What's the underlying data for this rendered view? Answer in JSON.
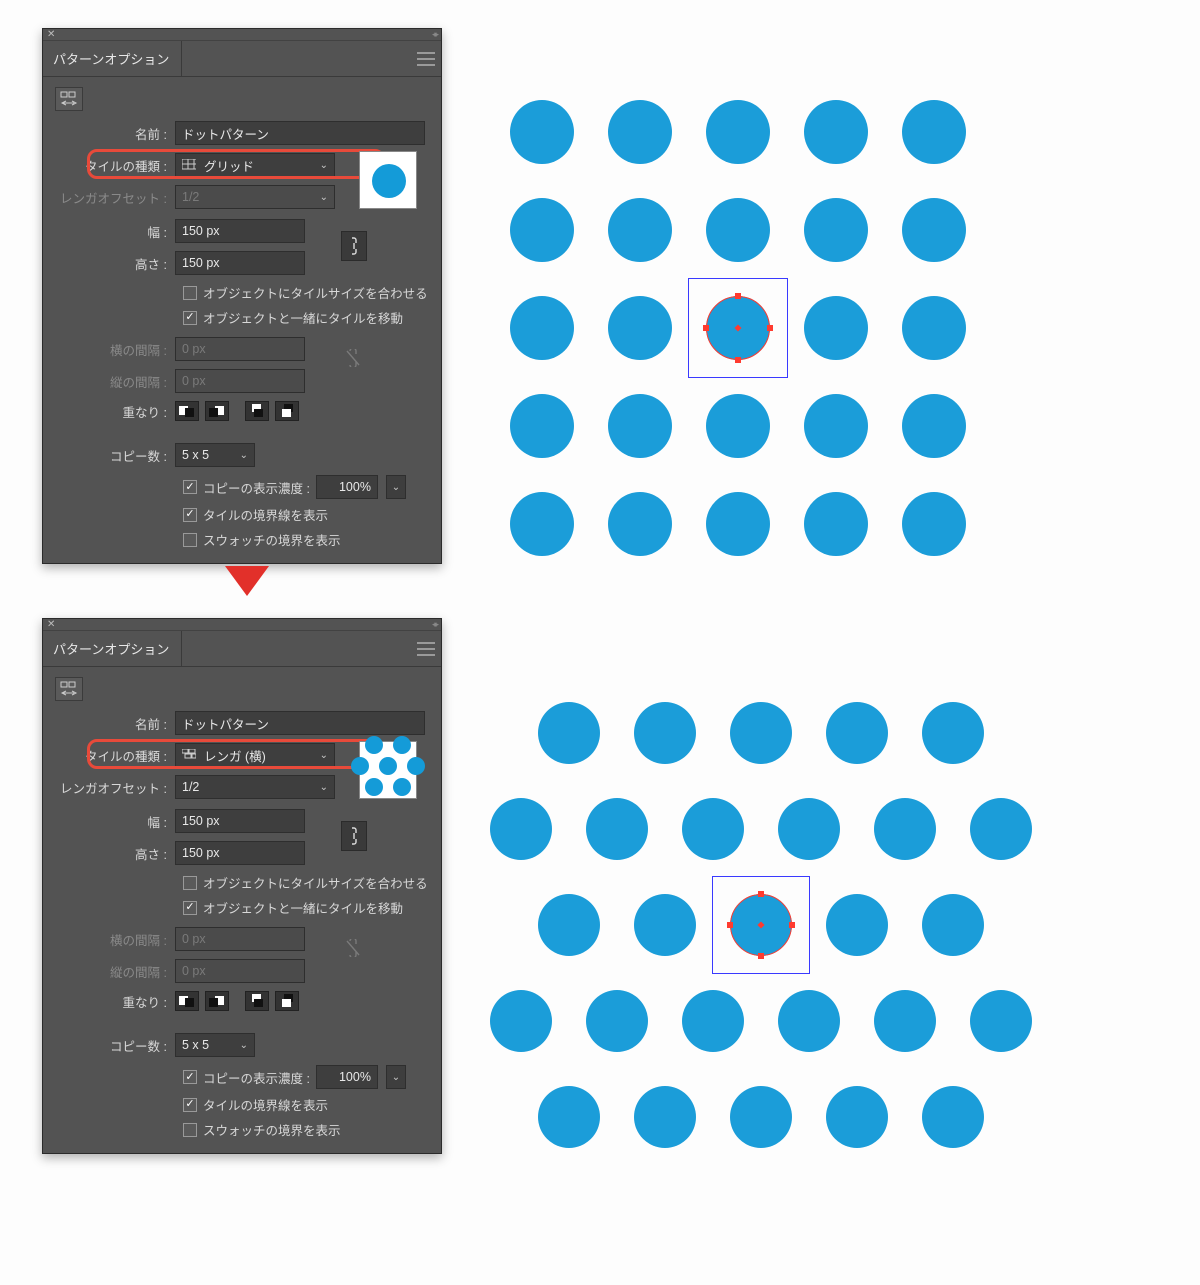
{
  "panel_title": "パターンオプション",
  "labels": {
    "name": "名前 :",
    "tile_type": "タイルの種類 :",
    "brick_offset": "レンガオフセット :",
    "width": "幅 :",
    "height": "高さ :",
    "h_spacing": "横の間隔 :",
    "v_spacing": "縦の間隔 :",
    "overlap": "重なり :",
    "copies": "コピー数 :"
  },
  "checkboxes": {
    "size_to_art": "オブジェクトにタイルサイズを合わせる",
    "move_with_art": "オブジェクトと一緒にタイルを移動",
    "dim_copies": "コピーの表示濃度 :",
    "show_tile_edge": "タイルの境界線を表示",
    "show_swatch_bounds": "スウォッチの境界を表示"
  },
  "common": {
    "name_value": "ドットパターン",
    "brick_offset_value": "1/2",
    "width_value": "150 px",
    "height_value": "150 px",
    "spacing_value": "0 px",
    "copies_value": "5 x 5",
    "density_value": "100%"
  },
  "top": {
    "tile_type_value": "グリッド",
    "brick_enabled": false
  },
  "bottom": {
    "tile_type_value": "レンガ (横)",
    "brick_enabled": true
  }
}
